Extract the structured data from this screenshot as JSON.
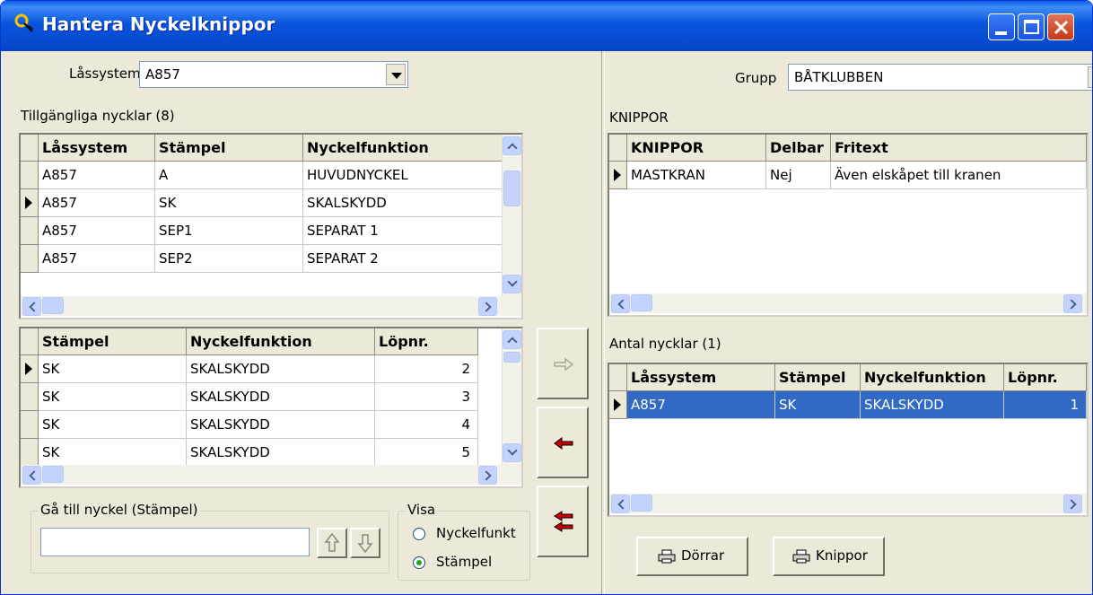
{
  "window": {
    "title": "Hantera Nyckelknippor"
  },
  "left": {
    "lassystem_label": "Låssystem",
    "lassystem_value": "A857",
    "available_title": "Tillgängliga nycklar (8)",
    "available_columns": [
      "Låssystem",
      "Stämpel",
      "Nyckelfunktion"
    ],
    "available_rows": [
      [
        "A857",
        "A",
        "HUVUDNYCKEL"
      ],
      [
        "A857",
        "SK",
        "SKALSKYDD"
      ],
      [
        "A857",
        "SEP1",
        "SEPARAT 1"
      ],
      [
        "A857",
        "SEP2",
        "SEPARAT 2"
      ]
    ],
    "detail_columns": [
      "Stämpel",
      "Nyckelfunktion",
      "Löpnr."
    ],
    "detail_rows": [
      [
        "SK",
        "SKALSKYDD",
        "2"
      ],
      [
        "SK",
        "SKALSKYDD",
        "3"
      ],
      [
        "SK",
        "SKALSKYDD",
        "4"
      ],
      [
        "SK",
        "SKALSKYDD",
        "5"
      ]
    ],
    "goto_legend": "Gå till nyckel (Stämpel)",
    "goto_value": "",
    "visa_legend": "Visa",
    "visa_options": [
      "Nyckelfunkt",
      "Stämpel"
    ],
    "visa_selected": "Stämpel"
  },
  "right": {
    "grupp_label": "Grupp",
    "grupp_value": "BÅTKLUBBEN",
    "knippor_title": "KNIPPOR",
    "knippor_columns": [
      "KNIPPOR",
      "Delbar",
      "Fritext"
    ],
    "knippor_rows": [
      [
        "MASTKRAN",
        "Nej",
        "Även elskåpet till kranen"
      ]
    ],
    "antal_title": "Antal nycklar (1)",
    "antal_columns": [
      "Låssystem",
      "Stämpel",
      "Nyckelfunktion",
      "Löpnr."
    ],
    "antal_rows": [
      [
        "A857",
        "SK",
        "SKALSKYDD",
        "1"
      ]
    ],
    "dorrar_button": "Dörrar",
    "knippor_button": "Knippor"
  },
  "colors": {
    "selection": "#316ac5",
    "move_arrow": "#cc0000"
  }
}
